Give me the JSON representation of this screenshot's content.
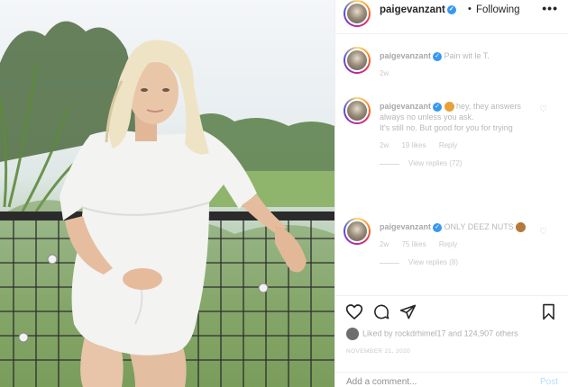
{
  "header": {
    "username": "paigevanzant",
    "separator": "•",
    "follow_status": "Following",
    "more_label": "•••"
  },
  "comments": [
    {
      "username": "paigevanzant",
      "text": "Pain wit le T.",
      "time": "2w"
    },
    {
      "username": "paigevanzant",
      "text_1": "hey, they answers always no unless you ask.",
      "text_2": "It's still no. But good for you for trying",
      "time": "2w",
      "likes": "19 likes",
      "reply": "Reply",
      "view_replies": "View replies (72)",
      "emoji_color": "#e8a23a"
    },
    {
      "username": "paigevanzant",
      "text": "ONLY DEEZ NUTS",
      "time": "2w",
      "likes": "75 likes",
      "reply": "Reply",
      "view_replies": "View replies (8)",
      "emoji_color": "#b5793a"
    }
  ],
  "post": {
    "liked_by": "Liked by ",
    "liked_user": "rockdrhimel17",
    "liked_and": " and ",
    "likes_count": "124,907 others",
    "date": "NOVEMBER 21, 2020"
  },
  "add_comment": {
    "placeholder": "Add a comment...",
    "post_label": "Post"
  },
  "icons": {
    "like": "heart-icon",
    "comment": "comment-icon",
    "share": "paper-plane-icon",
    "save": "bookmark-icon",
    "verified": "verified-badge-icon",
    "more": "more-options-icon"
  },
  "colors": {
    "verified_blue": "#3897f0",
    "post_disabled": "#b2dffc",
    "story_ring": "#d62976"
  }
}
